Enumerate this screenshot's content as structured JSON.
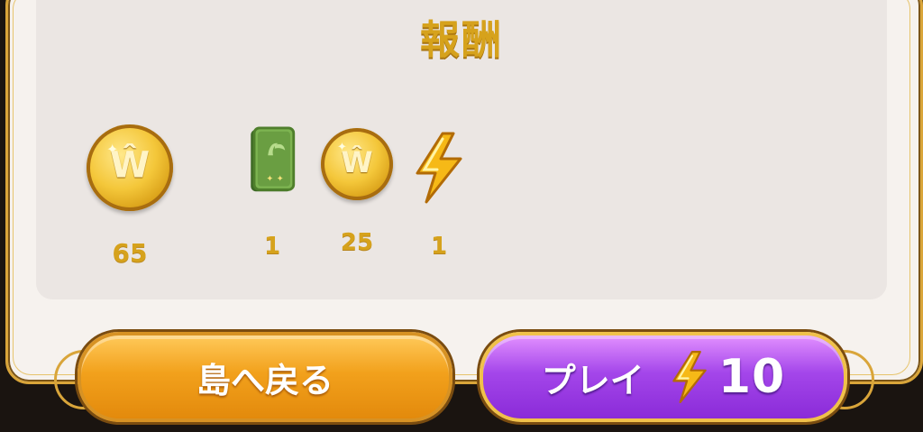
{
  "title": "報酬",
  "rewards": [
    {
      "item": "coin",
      "icon": "gold-coin-icon",
      "quantity": "65"
    },
    {
      "item": "book",
      "icon": "green-book-icon",
      "quantity": "1"
    },
    {
      "item": "coin",
      "icon": "gold-coin-icon",
      "quantity": "25"
    },
    {
      "item": "energy",
      "icon": "lightning-bolt-icon",
      "quantity": "1"
    }
  ],
  "buttons": {
    "back_label": "島へ戻る",
    "play_label": "プレイ",
    "play_cost": "10",
    "play_cost_icon": "lightning-bolt-icon"
  },
  "colors": {
    "gold": "#d6a21c",
    "orange_button": "#f2a11c",
    "purple_button": "#a446ea",
    "panel_background": "#ebe6e3"
  }
}
